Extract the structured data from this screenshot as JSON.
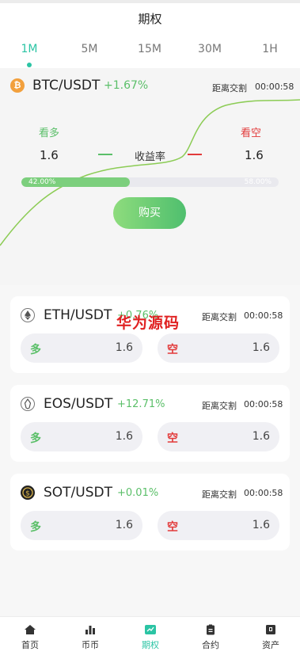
{
  "header": {
    "title": "期权"
  },
  "tabs": [
    {
      "label": "1M",
      "active": true
    },
    {
      "label": "5M",
      "active": false
    },
    {
      "label": "15M",
      "active": false
    },
    {
      "label": "30M",
      "active": false
    },
    {
      "label": "1H",
      "active": false
    }
  ],
  "hero": {
    "pair": "BTC/USDT",
    "change": "+1.67%",
    "countdown_label": "距离交割",
    "countdown": "00:00:58",
    "long_label": "看多",
    "short_label": "看空",
    "long_value": "1.6",
    "short_value": "1.6",
    "rate_label": "收益率",
    "progress_left": "42.00%",
    "progress_right": "58.00%",
    "progress_fraction": 0.42,
    "buy_label": "购买"
  },
  "markets": [
    {
      "pair": "ETH/USDT",
      "change": "+0.76%",
      "countdown_label": "距离交割",
      "countdown": "00:00:58",
      "long_label": "多",
      "long_value": "1.6",
      "short_label": "空",
      "short_value": "1.6",
      "icon": "eth-icon"
    },
    {
      "pair": "EOS/USDT",
      "change": "+12.71%",
      "countdown_label": "距离交割",
      "countdown": "00:00:58",
      "long_label": "多",
      "long_value": "1.6",
      "short_label": "空",
      "short_value": "1.6",
      "icon": "eos-icon"
    },
    {
      "pair": "SOT/USDT",
      "change": "+0.01%",
      "countdown_label": "距离交割",
      "countdown": "00:00:58",
      "long_label": "多",
      "long_value": "1.6",
      "short_label": "空",
      "short_value": "1.6",
      "icon": "sot-icon"
    }
  ],
  "watermark": "华为源码",
  "nav": [
    {
      "label": "首页",
      "icon": "home-icon",
      "active": false
    },
    {
      "label": "币币",
      "icon": "bar-chart-icon",
      "active": false
    },
    {
      "label": "期权",
      "icon": "options-icon",
      "active": true
    },
    {
      "label": "合约",
      "icon": "clipboard-icon",
      "active": false
    },
    {
      "label": "资产",
      "icon": "wallet-icon",
      "active": false
    }
  ],
  "colors": {
    "accent": "#2bc4a4",
    "up": "#5bbf69",
    "down": "#e23b3b"
  }
}
